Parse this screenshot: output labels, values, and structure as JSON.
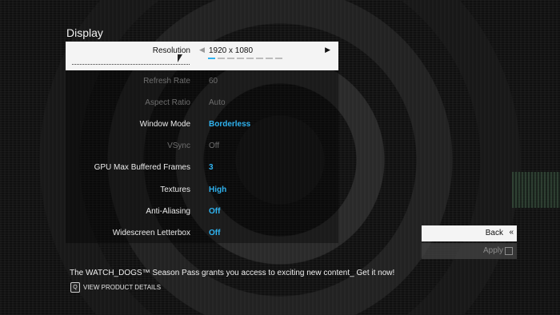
{
  "section_title": "Display",
  "settings": [
    {
      "label": "Resolution",
      "value": "1920 x 1080",
      "state": "selected",
      "steps_total": 8,
      "step_index": 0
    },
    {
      "label": "Refresh Rate",
      "value": "60",
      "state": "disabled"
    },
    {
      "label": "Aspect Ratio",
      "value": "Auto",
      "state": "disabled"
    },
    {
      "label": "Window Mode",
      "value": "Borderless",
      "state": "enabled"
    },
    {
      "label": "VSync",
      "value": "Off",
      "state": "disabled"
    },
    {
      "label": "GPU Max Buffered Frames",
      "value": "3",
      "state": "enabled"
    },
    {
      "label": "Textures",
      "value": "High",
      "state": "enabled"
    },
    {
      "label": "Anti-Aliasing",
      "value": "Off",
      "state": "enabled"
    },
    {
      "label": "Widescreen Letterbox",
      "value": "Off",
      "state": "enabled"
    }
  ],
  "buttons": {
    "back": "Back",
    "apply": "Apply"
  },
  "promo_text": "The WATCH_DOGS™ Season Pass grants you access to exciting new content_ Get it now!",
  "details": {
    "key": "Q",
    "label": "VIEW PRODUCT DETAILS"
  },
  "colors": {
    "accent": "#2fb3f0",
    "selected_row_bg": "#f4f4f4",
    "disabled_text": "#6e6e6e"
  },
  "icons": {
    "left_arrow": "left-arrow-icon",
    "right_arrow": "right-arrow-icon",
    "back": "double-chevron-left-icon",
    "apply": "square-icon"
  }
}
